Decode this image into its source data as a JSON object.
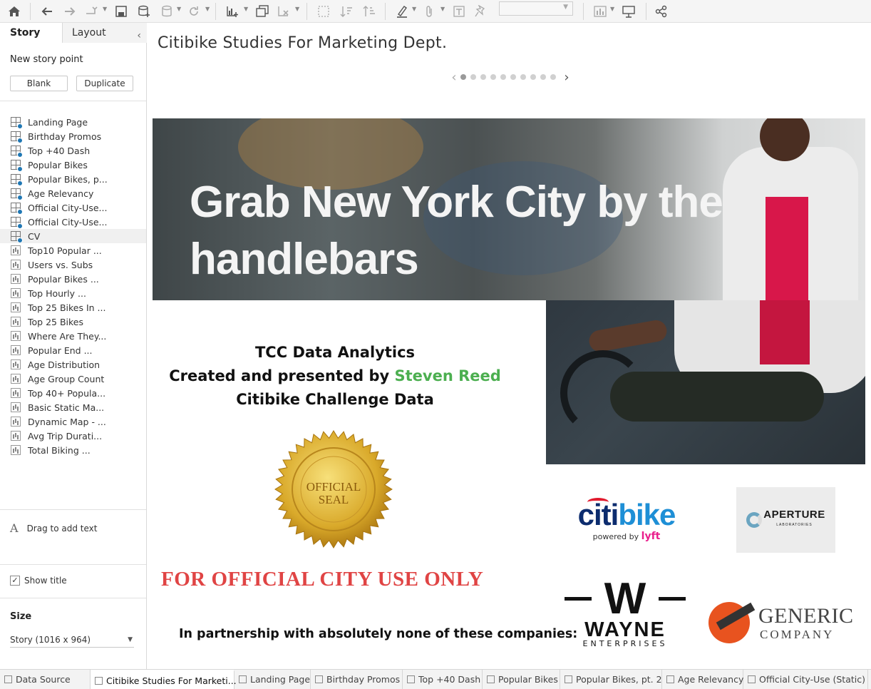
{
  "toolbar": {
    "icons": [
      "home-icon",
      "undo-icon",
      "redo-icon",
      "replay-icon",
      "save-icon",
      "new-data-source-icon",
      "pause-updates-icon",
      "refresh-icon",
      "new-worksheet-icon",
      "duplicate-icon",
      "clear-sheet-icon",
      "swap-icon",
      "sort-ascending-icon",
      "sort-descending-icon",
      "highlight-icon",
      "group-icon",
      "label-icon",
      "pin-icon",
      "show-me-icon",
      "presentation-icon",
      "share-icon"
    ]
  },
  "side_panel": {
    "tab_story": "Story",
    "tab_layout": "Layout",
    "new_story_point": "New story point",
    "blank_label": "Blank",
    "duplicate_label": "Duplicate",
    "sheets": [
      {
        "label": "Landing Page",
        "type": "dashboard"
      },
      {
        "label": "Birthday Promos",
        "type": "dashboard"
      },
      {
        "label": "Top +40 Dash",
        "type": "dashboard"
      },
      {
        "label": "Popular Bikes",
        "type": "dashboard"
      },
      {
        "label": "Popular Bikes, p...",
        "type": "dashboard"
      },
      {
        "label": "Age Relevancy",
        "type": "dashboard"
      },
      {
        "label": "Official City-Use...",
        "type": "dashboard"
      },
      {
        "label": "Official City-Use...",
        "type": "dashboard"
      },
      {
        "label": "CV",
        "type": "dashboard"
      },
      {
        "label": "Top10 Popular ...",
        "type": "sheet"
      },
      {
        "label": "Users vs. Subs",
        "type": "sheet"
      },
      {
        "label": "Popular Bikes ...",
        "type": "sheet"
      },
      {
        "label": "Top Hourly ...",
        "type": "sheet"
      },
      {
        "label": "Top 25 Bikes In ...",
        "type": "sheet"
      },
      {
        "label": "Top 25 Bikes",
        "type": "sheet"
      },
      {
        "label": "Where Are They...",
        "type": "sheet"
      },
      {
        "label": "Popular End ...",
        "type": "sheet"
      },
      {
        "label": "Age Distribution",
        "type": "sheet"
      },
      {
        "label": "Age Group Count",
        "type": "sheet"
      },
      {
        "label": "Top 40+ Popula...",
        "type": "sheet"
      },
      {
        "label": "Basic Static Ma...",
        "type": "sheet"
      },
      {
        "label": "Dynamic Map - ...",
        "type": "sheet"
      },
      {
        "label": "Avg Trip Durati...",
        "type": "sheet"
      },
      {
        "label": "Total Biking ...",
        "type": "sheet"
      }
    ],
    "drag_text": "Drag to add text",
    "show_title": "Show title",
    "show_title_checked": true,
    "size_heading": "Size",
    "size_value": "Story (1016 x 964)"
  },
  "story": {
    "title": "Citibike Studies For Marketing Dept.",
    "points_total": 10,
    "current_point": 1,
    "banner_line1": "Grab New York City by the",
    "banner_line2": "handlebars",
    "credit_line1": "TCC Data Analytics",
    "credit_line2_prefix": "Created and presented by ",
    "credit_name": "Steven Reed",
    "credit_line3": "Citibike Challenge Data",
    "seal_text_1": "OFFICIAL",
    "seal_text_2": "SEAL",
    "official_notice": "FOR OFFICIAL CITY USE ONLY",
    "partnership": "In partnership with absolutely none of these companies:",
    "citibike_w1": "citi",
    "citibike_w2": "bike",
    "citibike_powered": "powered by",
    "citibike_lyft": "lyft",
    "aperture_name": "APERTURE",
    "aperture_sub": "LABORATORIES",
    "wayne_name": "WAYNE",
    "wayne_sub": "ENTERPRISES",
    "generic_1": "GENERIC",
    "generic_2": "COMPANY",
    "accent_green": "#4caf50",
    "notice_red": "#e04444"
  },
  "tabs": [
    {
      "label": "Data Source",
      "active": false
    },
    {
      "label": "Citibike Studies For Marketi...",
      "active": true
    },
    {
      "label": "Landing Page",
      "active": false
    },
    {
      "label": "Birthday Promos",
      "active": false
    },
    {
      "label": "Top +40 Dash",
      "active": false
    },
    {
      "label": "Popular Bikes",
      "active": false
    },
    {
      "label": "Popular Bikes, pt. 2",
      "active": false
    },
    {
      "label": "Age Relevancy",
      "active": false
    },
    {
      "label": "Official City-Use (Static)",
      "active": false
    }
  ]
}
